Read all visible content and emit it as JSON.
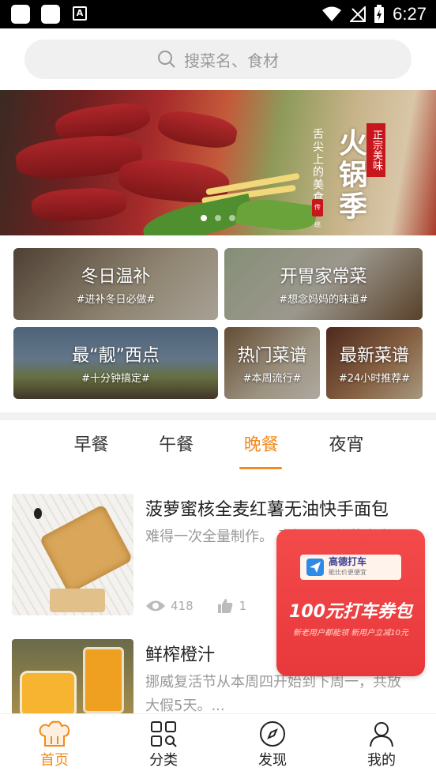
{
  "status_bar": {
    "time": "6:27"
  },
  "search": {
    "placeholder": "搜菜名、食材"
  },
  "banner": {
    "title": "火锅季",
    "slogan": "舌尖上的美食",
    "tag": "正宗美味",
    "seal": "传统",
    "slides": 3,
    "active_slide": 1
  },
  "categories": [
    {
      "title": "冬日温补",
      "subtitle": "#进补冬日必做#"
    },
    {
      "title": "开胃家常菜",
      "subtitle": "#想念妈妈的味道#"
    },
    {
      "title": "最“靓”西点",
      "subtitle": "#十分钟搞定#"
    },
    {
      "title": "热门菜谱",
      "subtitle": "#本周流行#"
    },
    {
      "title": "最新菜谱",
      "subtitle": "#24小时推荐#"
    }
  ],
  "meal_tabs": [
    "早餐",
    "午餐",
    "晚餐",
    "夜宵"
  ],
  "active_tab": "晚餐",
  "recipes": [
    {
      "title": "菠萝蜜核全麦红薯无油快手面包",
      "desc": "难得一次全量制作。 麦粉，又红薯多多。",
      "views": "418",
      "likes": "1"
    },
    {
      "title": "鲜榨橙汁",
      "desc": "挪威复活节从本周四开始到下周一，共放大假5天。..."
    }
  ],
  "ad": {
    "brand": "高德打车",
    "brand_sub": "能比价更便宜",
    "headline": "100元打车券包",
    "sub": "新老用户都能领 新用户立减10元"
  },
  "bottom_nav": [
    {
      "label": "首页",
      "icon": "chef-hat-icon",
      "active": true
    },
    {
      "label": "分类",
      "icon": "grid-search-icon",
      "active": false
    },
    {
      "label": "发现",
      "icon": "compass-icon",
      "active": false
    },
    {
      "label": "我的",
      "icon": "user-icon",
      "active": false
    }
  ],
  "colors": {
    "accent": "#f08b1e",
    "ad_red": "#e8383c"
  }
}
